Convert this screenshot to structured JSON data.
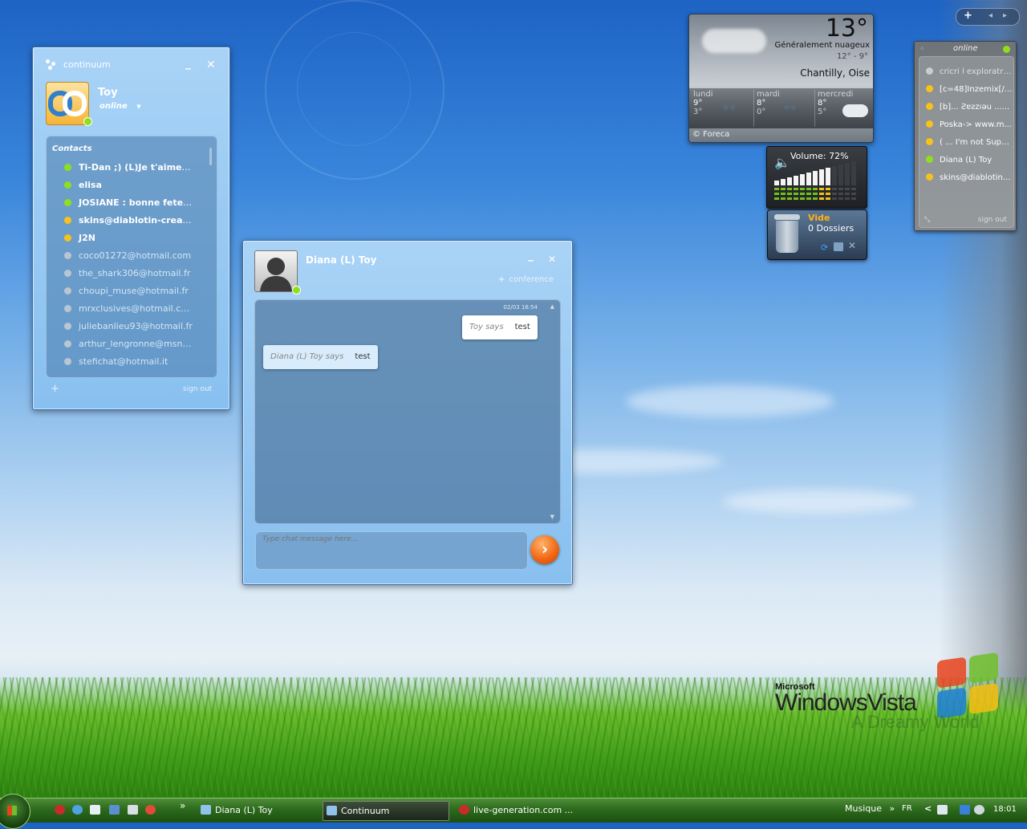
{
  "continuum_window": {
    "title": "continuum",
    "user_name": "Toy",
    "status": "online",
    "contacts_header": "Contacts",
    "contacts": [
      {
        "name": "Ti-Dan ;)  (L)Je t'aime AlexXx...",
        "status_color": "#8ee01a"
      },
      {
        "name": "elisa",
        "status_color": "#8ee01a"
      },
      {
        "name": "JOSIANE : bonne fete a toute...",
        "status_color": "#8ee01a"
      },
      {
        "name": "skins@diablotin-created.fr (...",
        "status_color": "#f7c21c"
      },
      {
        "name": "J2N",
        "status_color": "#f7c21c"
      },
      {
        "name": "coco01272@hotmail.com",
        "status_color": "#b9c6d2"
      },
      {
        "name": "the_shark306@hotmail.fr",
        "status_color": "#b9c6d2"
      },
      {
        "name": "choupi_muse@hotmail.fr",
        "status_color": "#b9c6d2"
      },
      {
        "name": "mrxclusives@hotmail.com",
        "status_color": "#b9c6d2"
      },
      {
        "name": "juliebanlieu93@hotmail.fr",
        "status_color": "#b9c6d2"
      },
      {
        "name": "arthur_lengronne@msn.com",
        "status_color": "#b9c6d2"
      },
      {
        "name": "stefichat@hotmail.it",
        "status_color": "#b9c6d2"
      }
    ],
    "add_label": "+",
    "signout_label": "sign out"
  },
  "chat_window": {
    "contact_name": "Diana (L) Toy",
    "conference_label": "conference",
    "timestamp": "02/03 16:54",
    "messages": [
      {
        "who": "Toy says",
        "text": "test"
      },
      {
        "who": "Diana (L) Toy says",
        "text": "test"
      }
    ],
    "input_placeholder": "Type chat message here..."
  },
  "weather": {
    "temperature": "13°",
    "condition": "Généralement nuageux",
    "high_low": "12°  -  9°",
    "location": "Chantilly, Oise",
    "forecast": [
      {
        "day": "lundi",
        "high": "9°",
        "low": "3°"
      },
      {
        "day": "mardi",
        "high": "8°",
        "low": "0°"
      },
      {
        "day": "mercredi",
        "high": "8°",
        "low": "5°"
      }
    ],
    "credit": "© Foreca"
  },
  "volume": {
    "label": "Volume: 72%",
    "level": 0.72
  },
  "recycle_bin": {
    "status": "Vide",
    "folders": "0 Dossiers"
  },
  "online_panel": {
    "title": "online",
    "contacts": [
      {
        "name": "cricri l exploratri...",
        "status_color": "#c9cdd0"
      },
      {
        "name": "[c=48]Inzemix[/...",
        "status_color": "#f7c21c"
      },
      {
        "name": "[b]... Ƨɐƨzıǝu  ......",
        "status_color": "#f7c21c"
      },
      {
        "name": "Poska-> www.m...",
        "status_color": "#f7c21c"
      },
      {
        "name": "( ... I'm not Supe...",
        "status_color": "#f7c21c"
      },
      {
        "name": "Diana (L) Toy",
        "status_color": "#8ee01a"
      },
      {
        "name": "skins@diablotin...",
        "status_color": "#f7c21c"
      }
    ],
    "signout_label": "sign out"
  },
  "sidebar_controls": {
    "add": "+",
    "prev": "◂",
    "next": "▸"
  },
  "desktop_logo": {
    "brand": "Microsoft",
    "product": "WindowsVista",
    "tagline": "A Dreamy World"
  },
  "taskbar": {
    "quick_launch_more": "»",
    "buttons": [
      {
        "label": "Diana (L) Toy"
      },
      {
        "label": "Continuum"
      },
      {
        "label": "live-generation.com ..."
      }
    ],
    "toolbar_label": "Musique",
    "toolbar_more": "»",
    "language": "FR",
    "tray_more": "<",
    "clock": "18:01"
  }
}
